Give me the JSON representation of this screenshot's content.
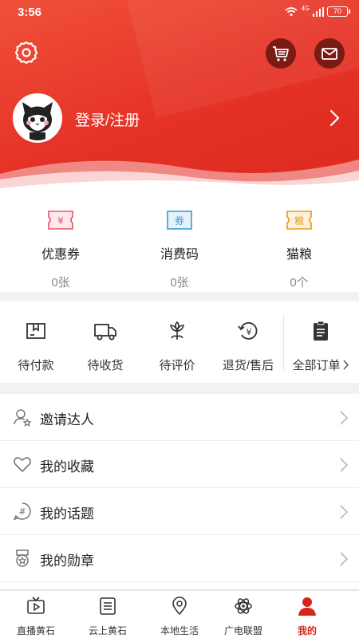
{
  "status_bar": {
    "time": "3:56",
    "network": "4G",
    "battery": "70"
  },
  "header": {
    "login_text": "登录/注册",
    "icons": {
      "settings": "gear-icon",
      "cart": "cart-icon",
      "message": "mail-icon",
      "next": "chevron-right-icon"
    }
  },
  "assets": [
    {
      "label": "优惠券",
      "count": "0张",
      "icon_text": "¥",
      "color": "#e8536c"
    },
    {
      "label": "消费码",
      "count": "0张",
      "icon_text": "券",
      "color": "#3a9ad9"
    },
    {
      "label": "猫粮",
      "count": "0个",
      "icon_text": "粮",
      "color": "#e89a1a"
    }
  ],
  "orders": [
    {
      "label": "待付款",
      "icon": "wallet-icon"
    },
    {
      "label": "待收货",
      "icon": "truck-icon"
    },
    {
      "label": "待评价",
      "icon": "flower-icon"
    },
    {
      "label": "退货/售后",
      "icon": "refund-icon"
    },
    {
      "label": "全部订单",
      "icon": "clipboard-icon"
    }
  ],
  "menu": [
    {
      "label": "邀请达人",
      "icon": "invite-icon"
    },
    {
      "label": "我的收藏",
      "icon": "heart-icon"
    },
    {
      "label": "我的话题",
      "icon": "topic-icon"
    },
    {
      "label": "我的勋章",
      "icon": "medal-icon"
    }
  ],
  "tabbar": [
    {
      "label": "直播黄石",
      "icon": "tv-icon",
      "active": false
    },
    {
      "label": "云上黄石",
      "icon": "list-icon",
      "active": false
    },
    {
      "label": "本地生活",
      "icon": "location-icon",
      "active": false
    },
    {
      "label": "广电联盟",
      "icon": "atom-icon",
      "active": false
    },
    {
      "label": "我的",
      "icon": "person-icon",
      "active": true
    }
  ],
  "colors": {
    "primary": "#e53226",
    "dark_button": "#7a1a14",
    "active_tab": "#d8241b"
  }
}
